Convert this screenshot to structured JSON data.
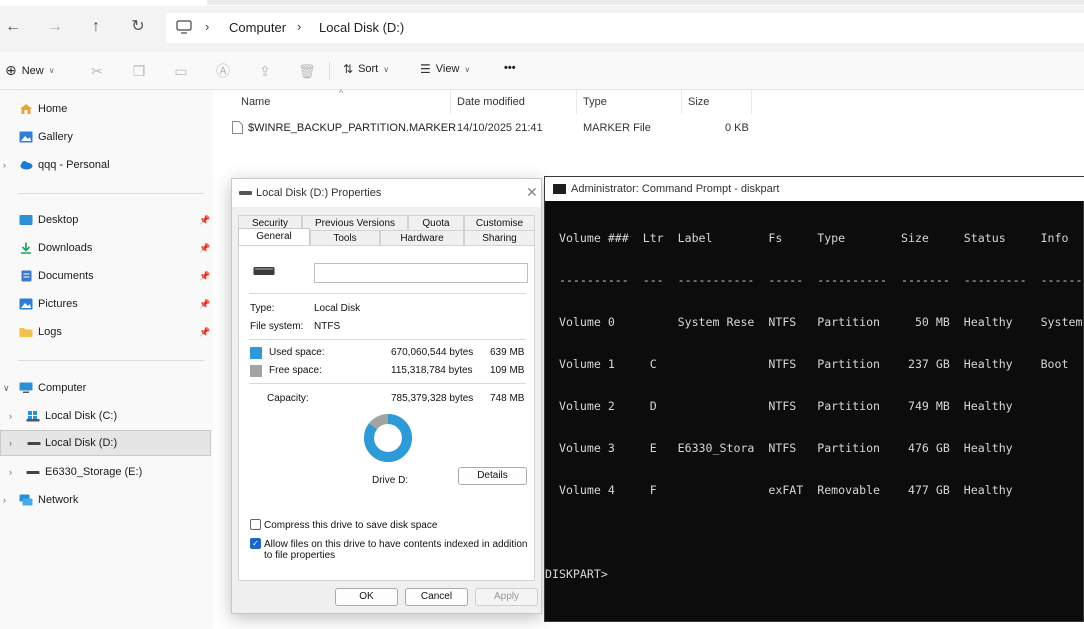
{
  "explorer": {
    "breadcrumb": [
      "Computer",
      "Local Disk (D:)"
    ],
    "toolbar": {
      "new_label": "New",
      "sort_label": "Sort",
      "view_label": "View",
      "more_label": "•••"
    },
    "sidebar": {
      "top": [
        {
          "label": "Home"
        },
        {
          "label": "Gallery"
        },
        {
          "label": "qqq - Personal"
        }
      ],
      "pinned": [
        {
          "label": "Desktop"
        },
        {
          "label": "Downloads"
        },
        {
          "label": "Documents"
        },
        {
          "label": "Pictures"
        },
        {
          "label": "Logs"
        }
      ],
      "computer_label": "Computer",
      "drives": [
        {
          "label": "Local Disk (C:)"
        },
        {
          "label": "Local Disk (D:)"
        },
        {
          "label": "E6330_Storage (E:)"
        }
      ],
      "network_label": "Network"
    },
    "columns": {
      "name": "Name",
      "date": "Date modified",
      "type": "Type",
      "size": "Size"
    },
    "files": [
      {
        "name": "$WINRE_BACKUP_PARTITION.MARKER",
        "date": "14/10/2025 21:41",
        "type": "MARKER File",
        "size": "0 KB"
      }
    ]
  },
  "properties": {
    "title": "Local Disk (D:) Properties",
    "tabs_row1": [
      "Security",
      "Previous Versions",
      "Quota",
      "Customise"
    ],
    "tabs_row2": [
      "General",
      "Tools",
      "Hardware",
      "Sharing"
    ],
    "name_value": "",
    "type_label": "Type:",
    "type_value": "Local Disk",
    "fs_label": "File system:",
    "fs_value": "NTFS",
    "used_label": "Used space:",
    "used_bytes": "670,060,544 bytes",
    "used_size": "639 MB",
    "free_label": "Free space:",
    "free_bytes": "115,318,784 bytes",
    "free_size": "109 MB",
    "capacity_label": "Capacity:",
    "capacity_bytes": "785,379,328 bytes",
    "capacity_size": "748 MB",
    "used_fraction": 0.853,
    "used_color": "#2e9ad8",
    "free_color": "#a3a3a3",
    "drive_label": "Drive D:",
    "details_label": "Details",
    "compress_label": "Compress this drive to save disk space",
    "compress_checked": false,
    "index_label": "Allow files on this drive to have contents indexed in addition to file properties",
    "index_checked": true,
    "ok_label": "OK",
    "cancel_label": "Cancel",
    "apply_label": "Apply"
  },
  "cmd": {
    "title": "Administrator: Command Prompt - diskpart",
    "lines": [
      "  Volume ###  Ltr  Label        Fs     Type        Size     Status     Info",
      "  ----------  ---  -----------  -----  ----------  -------  ---------  --------",
      "  Volume 0         System Rese  NTFS   Partition     50 MB  Healthy    System",
      "  Volume 1     C                NTFS   Partition    237 GB  Healthy    Boot",
      "  Volume 2     D                NTFS   Partition    749 MB  Healthy",
      "  Volume 3     E   E6330_Stora  NTFS   Partition    476 GB  Healthy",
      "  Volume 4     F                exFAT  Removable    477 GB  Healthy",
      "",
      "DISKPART>"
    ]
  }
}
